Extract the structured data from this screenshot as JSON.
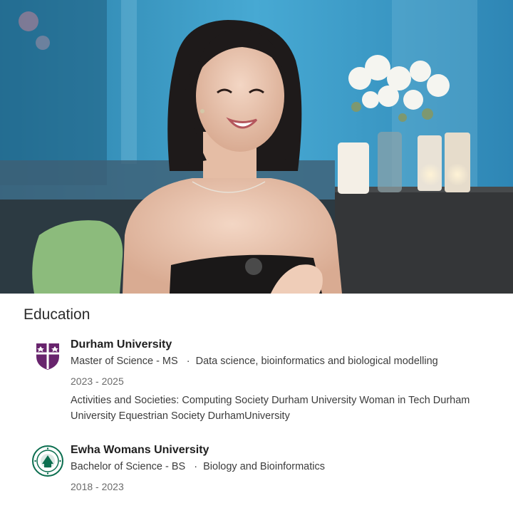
{
  "section": {
    "title": "Education"
  },
  "entries": [
    {
      "school": "Durham University",
      "degree": "Master of Science - MS",
      "separator": "·",
      "field": "Data science, bioinformatics and biological modelling",
      "dates": "2023 - 2025",
      "activities": "Activities and Societies: Computing Society Durham University Woman in Tech Durham University Equestrian Society DurhamUniversity",
      "logo_icon": "durham-crest-icon",
      "logo_color": "#68246d"
    },
    {
      "school": "Ewha Womans University",
      "degree": "Bachelor of Science - BS",
      "separator": "·",
      "field": "Biology and Bioinformatics",
      "dates": "2018 - 2023",
      "logo_icon": "ewha-seal-icon",
      "logo_color": "#0b6e4f"
    }
  ],
  "colors": {
    "background": "#ffffff",
    "photo_backdrop": "#3fa3c9"
  }
}
